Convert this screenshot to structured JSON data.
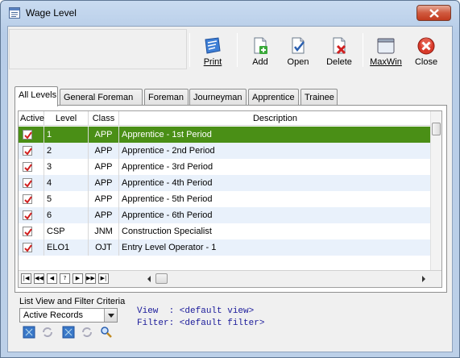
{
  "window": {
    "title": "Wage Level"
  },
  "toolbar": {
    "print": "Print",
    "add": "Add",
    "open": "Open",
    "delete": "Delete",
    "maxwin": "MaxWin",
    "close": "Close"
  },
  "tabs": [
    "All Levels",
    "General Foreman",
    "Foreman",
    "Journeyman",
    "Apprentice",
    "Trainee"
  ],
  "grid": {
    "columns": [
      "Active",
      "Level",
      "Class",
      "Description"
    ],
    "rows": [
      {
        "level": "1",
        "class": "APP",
        "description": "Apprentice - 1st Period"
      },
      {
        "level": "2",
        "class": "APP",
        "description": "Apprentice - 2nd Period"
      },
      {
        "level": "3",
        "class": "APP",
        "description": "Apprentice - 3rd Period"
      },
      {
        "level": "4",
        "class": "APP",
        "description": "Apprentice - 4th Period"
      },
      {
        "level": "5",
        "class": "APP",
        "description": "Apprentice - 5th Period"
      },
      {
        "level": "6",
        "class": "APP",
        "description": "Apprentice - 6th Period"
      },
      {
        "level": "CSP",
        "class": "JNM",
        "description": "Construction Specialist"
      },
      {
        "level": "ELO1",
        "class": "OJT",
        "description": "Entry Level Operator - 1"
      }
    ],
    "selected_row": 0,
    "nav_buttons": [
      "|◀",
      "◀◀",
      "◀",
      "?",
      "▶",
      "▶▶",
      "▶|"
    ]
  },
  "filter": {
    "label": "List View and Filter Criteria",
    "selected": "Active Records",
    "view_line": "View  : <default view>",
    "filter_line": "Filter: <default filter>"
  },
  "colors": {
    "selected_row": "#4a8f16",
    "alt_row": "#e9f1fb",
    "mono_text": "#1a1a9a"
  }
}
